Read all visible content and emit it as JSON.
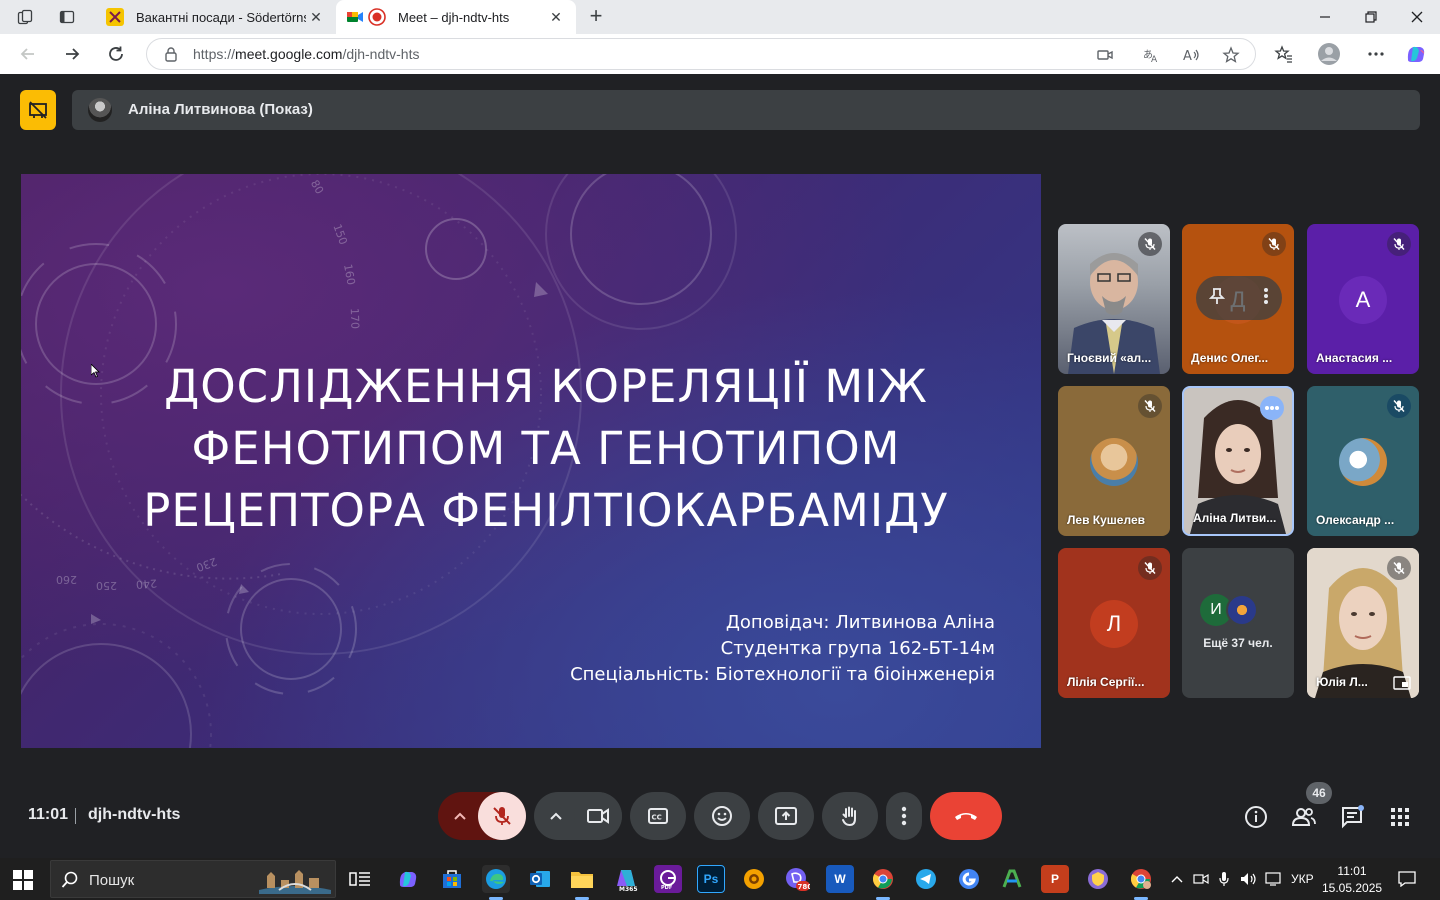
{
  "browser": {
    "tabs": [
      {
        "title": "Вакантні посади - Södertörns hö",
        "active": false
      },
      {
        "title": "Meet – djh-ndtv-hts",
        "active": true
      }
    ],
    "url_prefix": "https://",
    "url_host": "meet.google.com",
    "url_path": "/djh-ndtv-hts"
  },
  "meet": {
    "presenter_label": "Аліна Литвинова (Показ)",
    "slide": {
      "title_line1": "ДОСЛІДЖЕННЯ КОРЕЛЯЦІЇ МІЖ",
      "title_line2": "ФЕНОТИПОМ ТА ГЕНОТИПОМ",
      "title_line3": "РЕЦЕПТОРА ФЕНІЛТІОКАРБАМІДУ",
      "speaker": "Доповідач: Литвинова Аліна",
      "group": "Студентка група 162-БТ-14м",
      "specialty": "Спеціальність: Біотехнології та біоінженерія",
      "dial_numbers": [
        "260",
        "250",
        "240",
        "230",
        "150",
        "160",
        "170",
        "80"
      ]
    },
    "participants": [
      {
        "name": "Гноєвий «ал...",
        "muted": true
      },
      {
        "name": "Денис Олег...",
        "muted": true,
        "initial": "Д"
      },
      {
        "name": "Анастасия ...",
        "muted": true,
        "initial": "А"
      },
      {
        "name": "Лев Кушелев",
        "muted": true
      },
      {
        "name": "Аліна Литви...",
        "muted": false,
        "speaking": true
      },
      {
        "name": "Олександр ...",
        "muted": true
      },
      {
        "name": "Лілія Сергії...",
        "muted": true,
        "initial": "Л"
      },
      {
        "name": "Ещё 37 чел.",
        "initial": "И"
      },
      {
        "name": "Юлія Л...",
        "muted": true
      }
    ],
    "time": "11:01",
    "meeting_code": "djh-ndtv-hts",
    "people_count": "46",
    "colors": {
      "accent": "#fbbc04",
      "end_call": "#ea4335",
      "mic_off": "#f9dedc",
      "mic_off_icon": "#b3261e"
    }
  },
  "taskbar": {
    "search_label": "Пошук",
    "outlook_badge": "780",
    "lang": "УКР",
    "time": "11:01",
    "date": "15.05.2025"
  }
}
